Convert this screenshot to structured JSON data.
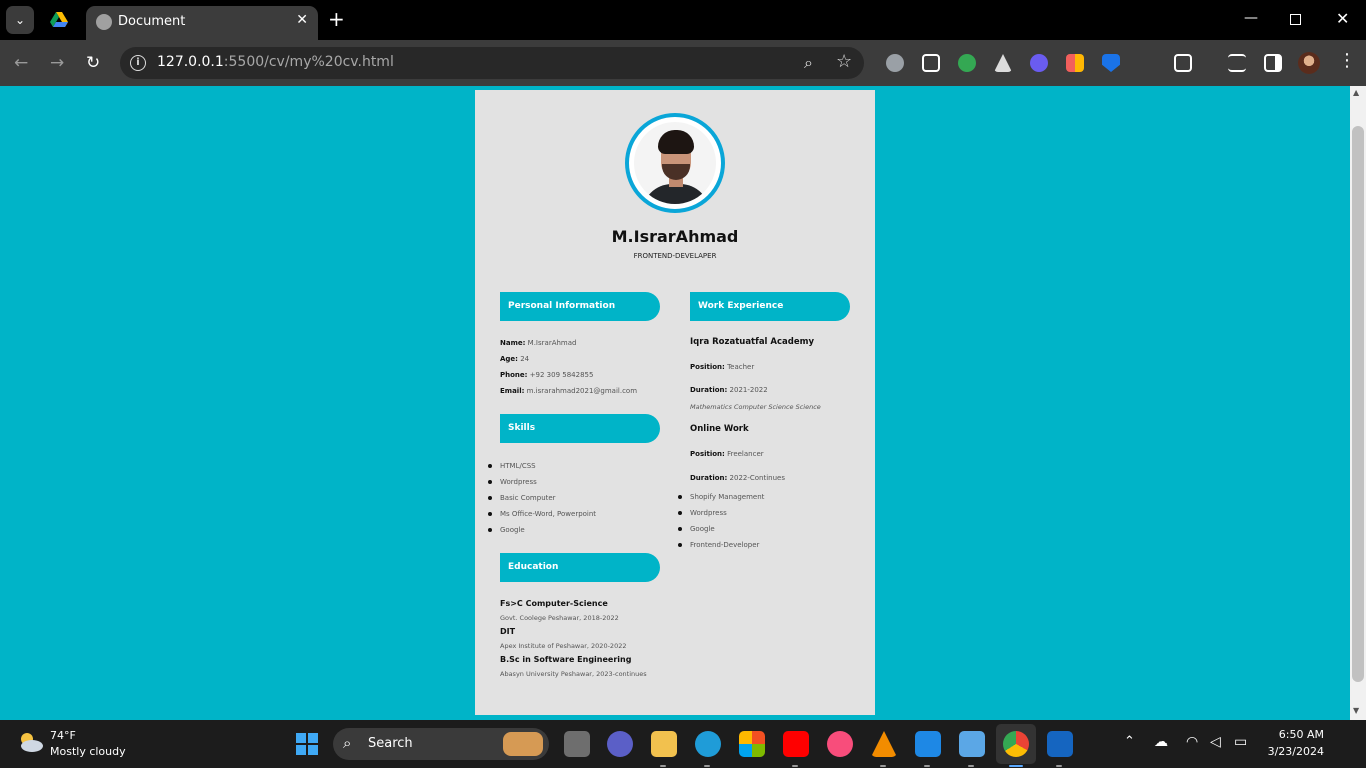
{
  "browser": {
    "tab_title": "Document",
    "url_host": "127.0.0.1",
    "url_path": ":5500/cv/my%20cv.html"
  },
  "cv": {
    "name": "M.IsrarAhmad",
    "role": "FRONTEND-DEVELAPER",
    "personal": {
      "heading": "Personal Information",
      "name_label": "Name:",
      "name_value": "M.IsrarAhmad",
      "age_label": "Age:",
      "age_value": "24",
      "phone_label": "Phone:",
      "phone_value": "+92 309 5842855",
      "email_label": "Email:",
      "email_value": "m.israrahmad2021@gmail.com"
    },
    "skills": {
      "heading": "Skills",
      "items": [
        "HTML/CSS",
        "Wordpress",
        "Basic Computer",
        "Ms Office-Word, Powerpoint",
        "Google"
      ]
    },
    "education": {
      "heading": "Education",
      "items": [
        {
          "title": "Fs>C Computer-Science",
          "sub": "Govt. Coolege Peshawar, 2018-2022"
        },
        {
          "title": "DIT",
          "sub": "Apex Institute of Peshawar, 2020-2022"
        },
        {
          "title": "B.Sc in Software Engineering",
          "sub": "Abasyn University Peshawar, 2023-continues"
        }
      ]
    },
    "work": {
      "heading": "Work Experience",
      "job1": {
        "title": "Iqra Rozatuatfal Academy",
        "position_label": "Position:",
        "position_value": "Teacher",
        "duration_label": "Duration:",
        "duration_value": "2021-2022",
        "note": "Mathematics Computer Science Science"
      },
      "job2": {
        "title": "Online Work",
        "position_label": "Position:",
        "position_value": "Freelancer",
        "duration_label": "Duration:",
        "duration_value": "2022-Continues",
        "items": [
          "Shopify Management",
          "Wordpress",
          "Google",
          "Frontend-Developer"
        ]
      }
    }
  },
  "taskbar": {
    "weather_temp": "74°F",
    "weather_desc": "Mostly cloudy",
    "search_label": "Search",
    "time": "6:50 AM",
    "date": "3/23/2024"
  }
}
